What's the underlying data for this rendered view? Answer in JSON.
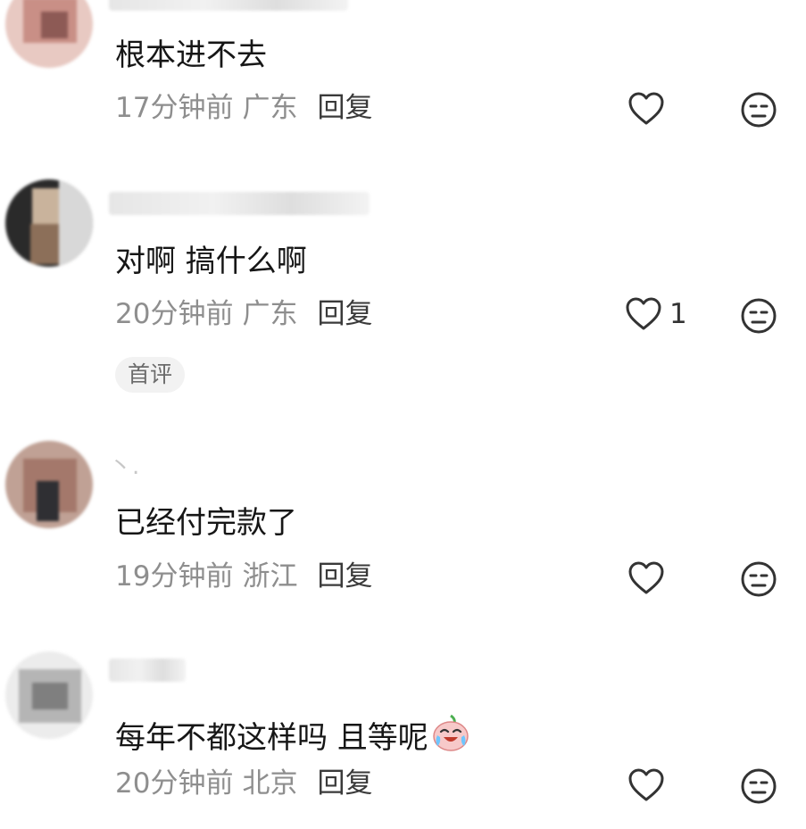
{
  "comments": [
    {
      "text": "根本进不去",
      "time": "17分钟前",
      "location": "广东",
      "reply": "回复",
      "likes": ""
    },
    {
      "text": "对啊 搞什么啊",
      "time": "20分钟前",
      "location": "广东",
      "reply": "回复",
      "likes": "1",
      "badge": "首评"
    },
    {
      "text": "已经付完款了",
      "time": "19分钟前",
      "location": "浙江",
      "reply": "回复",
      "likes": "",
      "username_visible": "丶."
    },
    {
      "text": "每年不都这样吗 且等呢",
      "time": "20分钟前",
      "location": "北京",
      "reply": "回复",
      "likes": ""
    }
  ],
  "icons": {
    "like": "heart-outline-icon",
    "dislike": "meh-face-icon",
    "emoji": "crying-laughing-peach-emoji"
  },
  "colors": {
    "meta": "#8e8e8e",
    "text": "#161616",
    "icon": "#333333",
    "badge_bg": "#f2f2f2"
  }
}
